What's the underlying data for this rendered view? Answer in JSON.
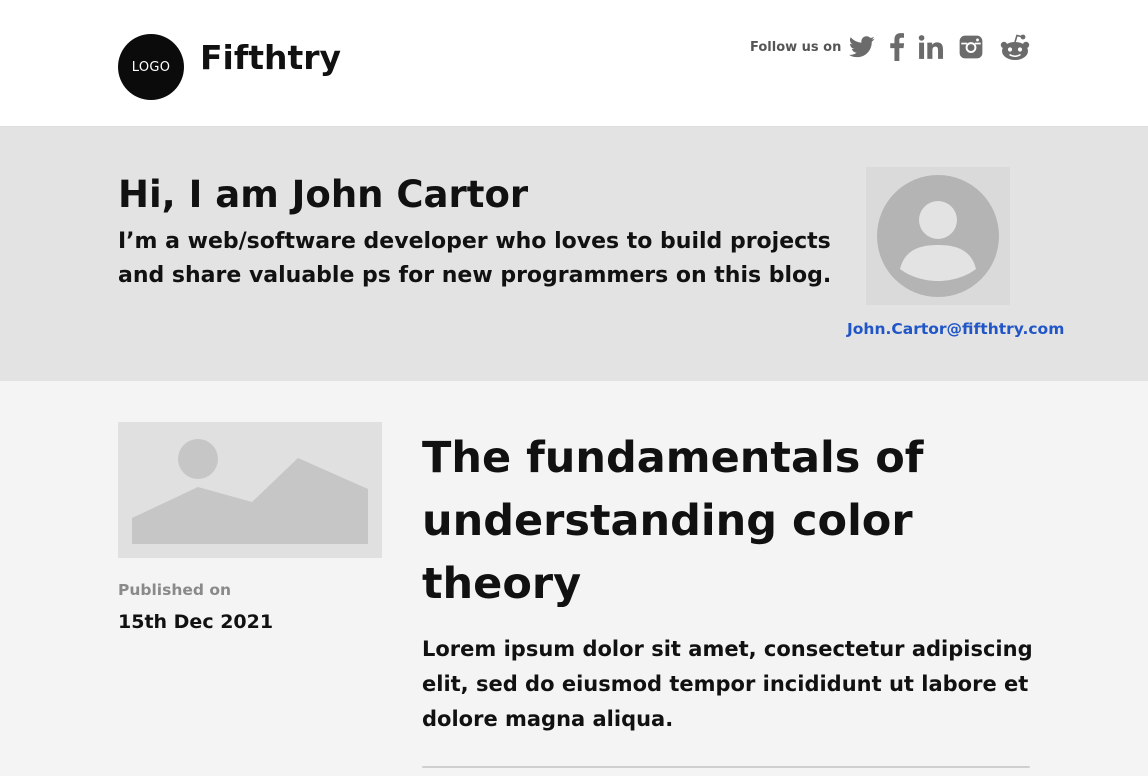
{
  "header": {
    "logo_text": "LOGO",
    "site_name": "Fifthtry",
    "follow_label": "Follow us on",
    "social": [
      {
        "name": "twitter-icon"
      },
      {
        "name": "facebook-icon"
      },
      {
        "name": "linkedin-icon"
      },
      {
        "name": "instagram-icon"
      },
      {
        "name": "reddit-icon"
      }
    ],
    "icon_color": "#6b6b6b"
  },
  "hero": {
    "title": "Hi, I am John Cartor",
    "subtitle": "I’m a web/software developer who loves to build projects and share valuable ps for new programmers on this blog.",
    "avatar_icon": "user-avatar-icon",
    "email": "John.Cartor@fifthtry.com",
    "email_color": "#2156c7"
  },
  "post": {
    "image_icon": "image-placeholder-icon",
    "published_label": "Published on",
    "published_date": "15th Dec 2021",
    "title": "The fundamentals of understanding color theory",
    "excerpt": "Lorem ipsum dolor sit amet, consectetur adipiscing elit, sed do eiusmod tempor incididunt ut labore et dolore magna aliqua."
  }
}
